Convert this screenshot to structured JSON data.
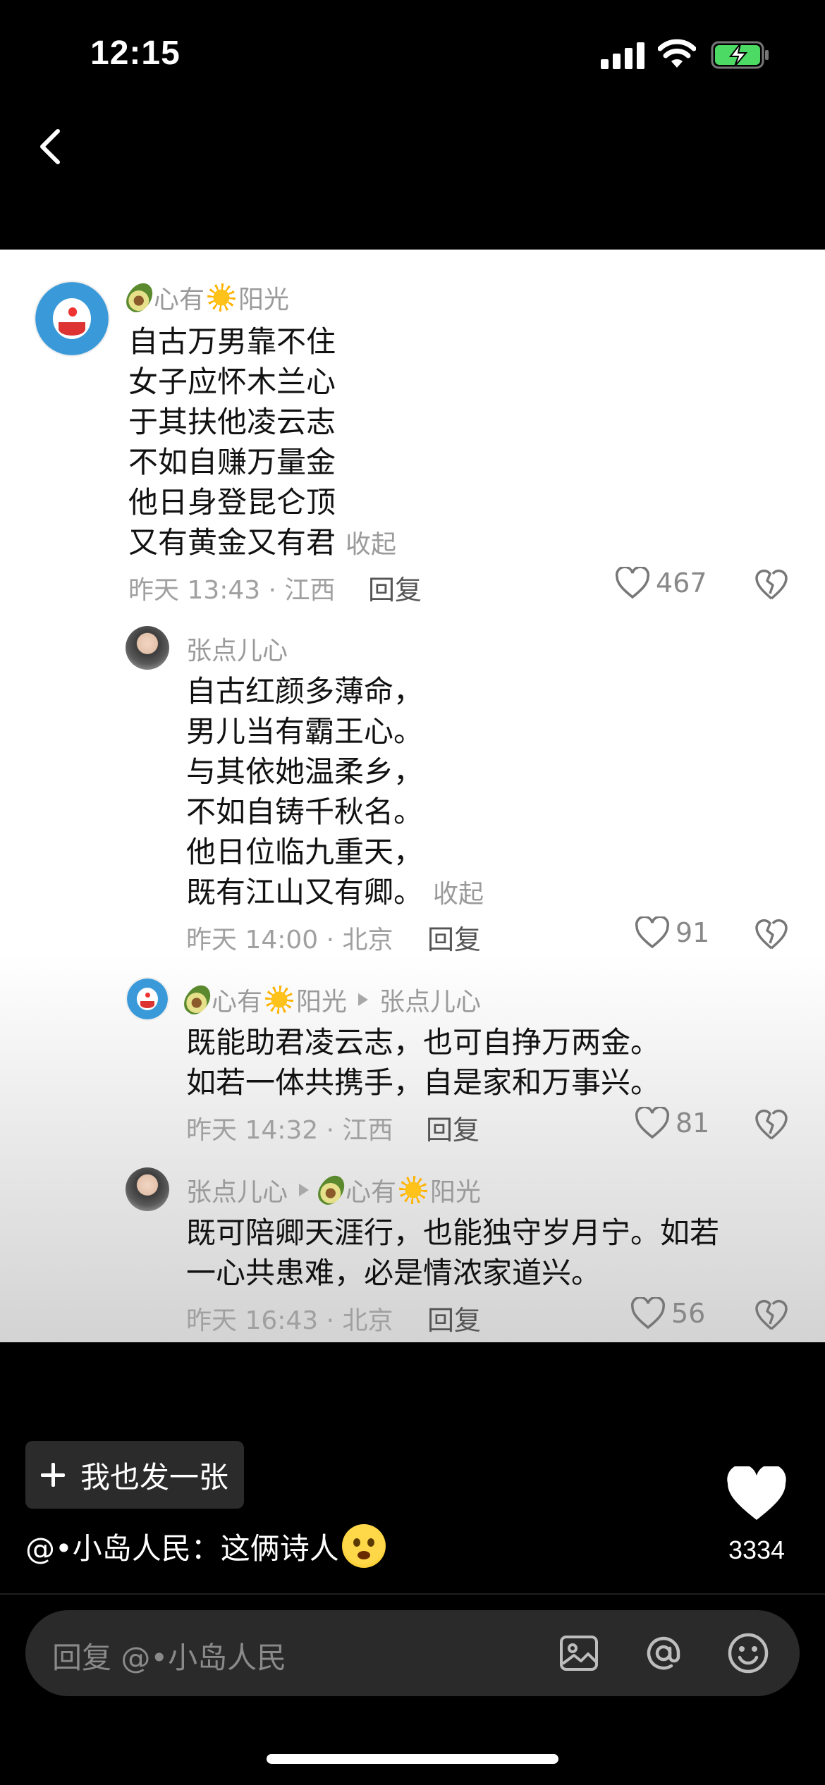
{
  "status_bar": {
    "time": "12:15"
  },
  "comments": [
    {
      "user": "心有",
      "user_suffix": "阳光",
      "lines": [
        "自古万男靠不住",
        "女子应怀木兰心",
        "于其扶他凌云志",
        "不如自赚万量金",
        "他日身登昆仑顶",
        "又有黄金又有君"
      ],
      "collapse": "收起",
      "time": "昨天 13:43 · 江西",
      "reply": "回复",
      "likes": "467"
    },
    {
      "user": "张点儿心",
      "lines": [
        "自古红颜多薄命，",
        "男儿当有霸王心。",
        "与其依她温柔乡，",
        "不如自铸千秋名。",
        "他日位临九重天，",
        "既有江山又有卿。"
      ],
      "collapse": "收起",
      "time": "昨天 14:00 · 北京",
      "reply": "回复",
      "likes": "91"
    },
    {
      "user": "心有",
      "user_suffix": "阳光",
      "reply_to": "张点儿心",
      "lines": [
        "既能助君凌云志，也可自挣万两金。",
        "如若一体共携手，自是家和万事兴。"
      ],
      "time": "昨天 14:32 · 江西",
      "reply": "回复",
      "likes": "81"
    },
    {
      "user": "张点儿心",
      "reply_to": "心有",
      "reply_to_suffix": "阳光",
      "lines": [
        "既可陪卿天涯行，也能独守岁月宁。如若",
        "一心共患难，必是情浓家道兴。"
      ],
      "time": "昨天 16:43 · 北京",
      "reply": "回复",
      "likes": "56"
    }
  ],
  "post_button": "我也发一张",
  "caption": "@•小岛人民：这俩诗人",
  "total_likes": "3334",
  "input": {
    "placeholder": "回复 @•小岛人民"
  },
  "icons": [
    "back-chevron-icon",
    "signal-icon",
    "wifi-icon",
    "battery-charging-icon",
    "heart-icon",
    "dislike-heart-icon",
    "image-icon",
    "at-icon",
    "emoji-icon"
  ]
}
